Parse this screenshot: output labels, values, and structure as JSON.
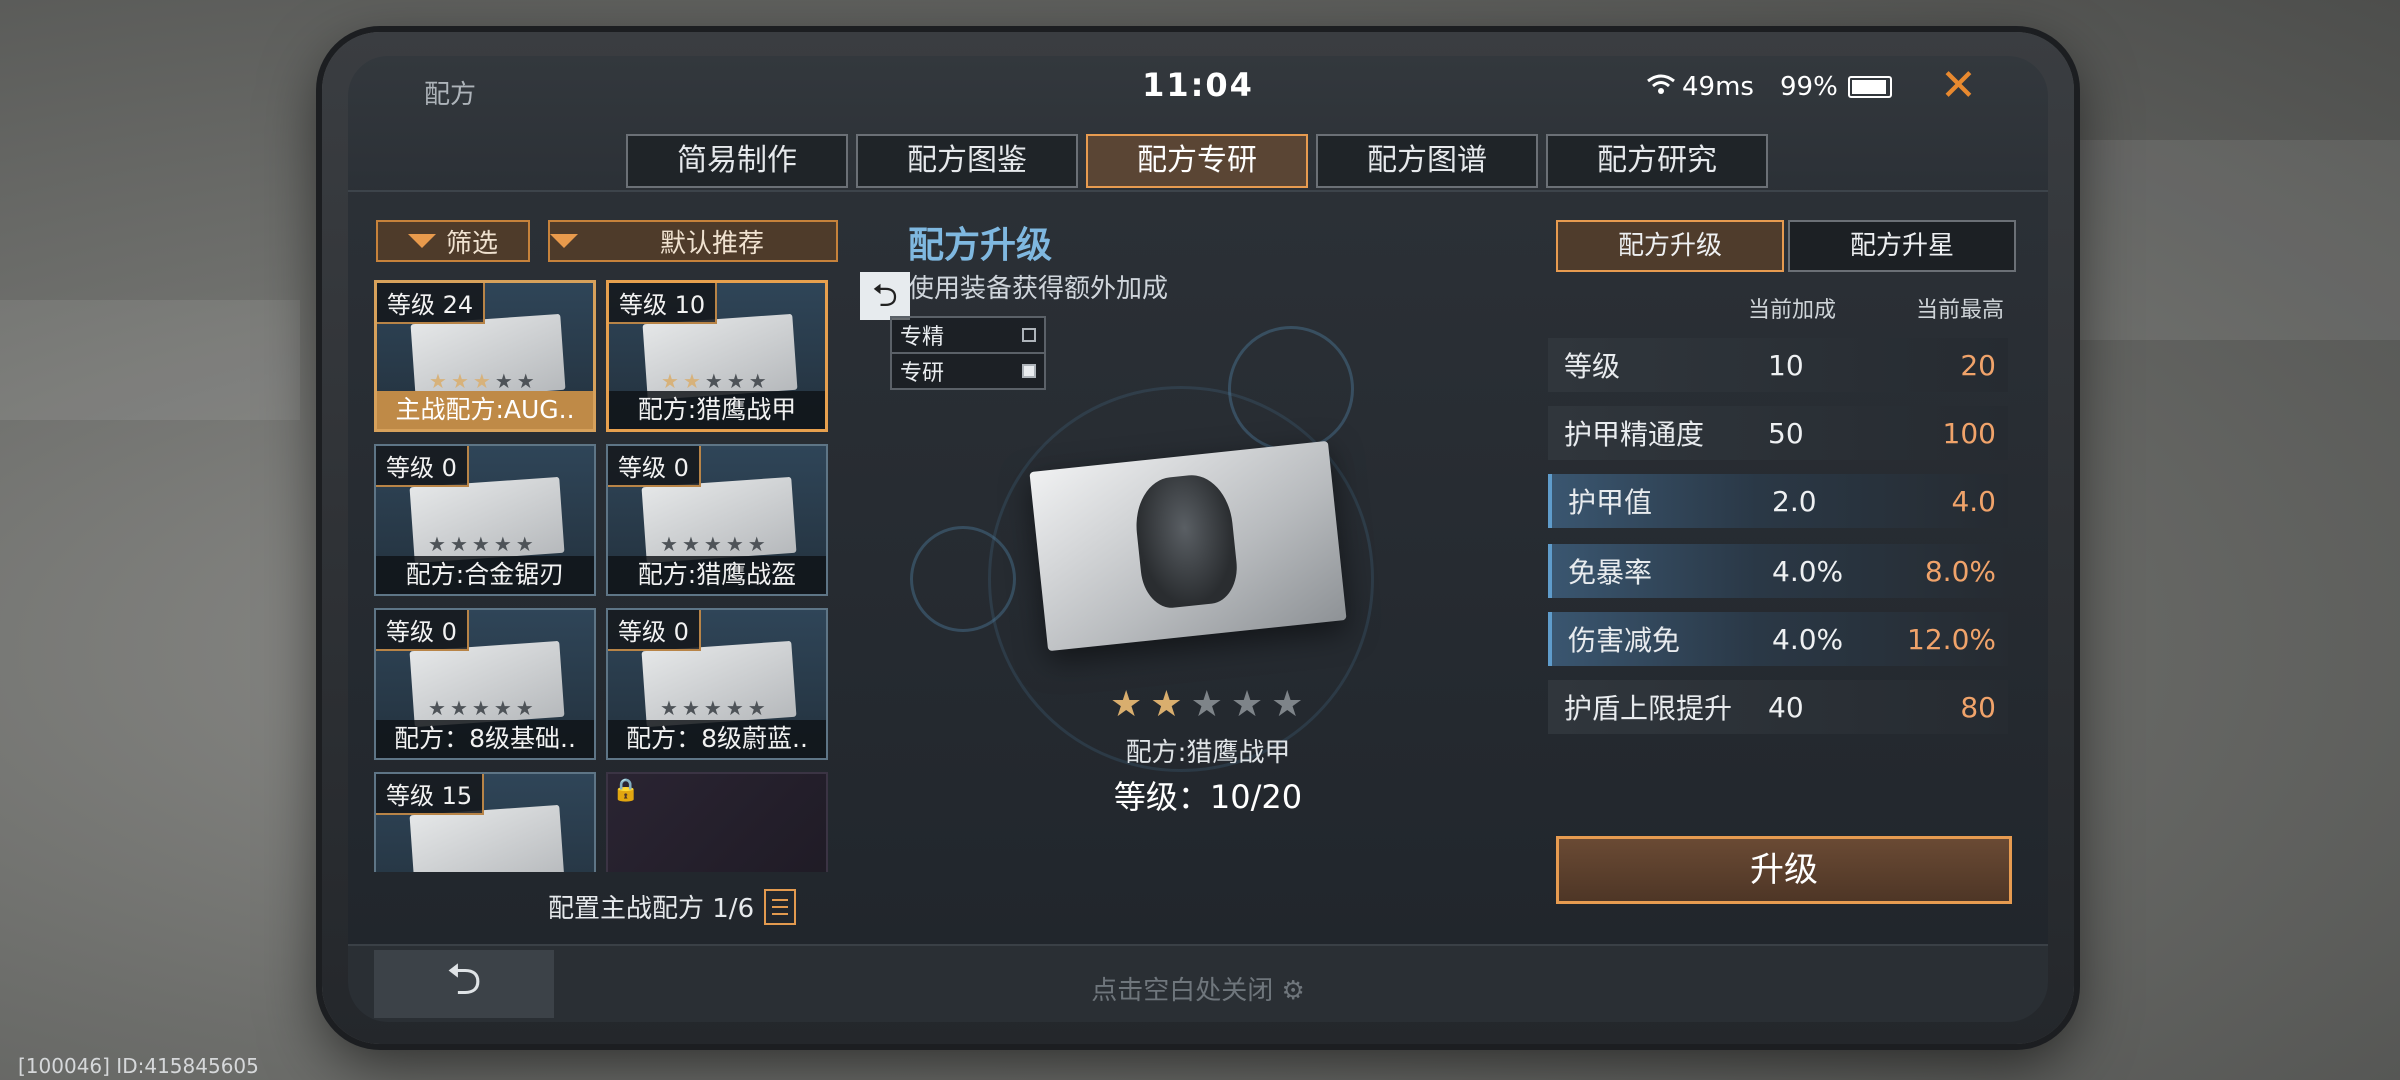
{
  "top": {
    "title": "配方",
    "time": "11:04",
    "ping": "49ms",
    "battery": "99%"
  },
  "main_tabs": [
    {
      "label": "简易制作",
      "active": false
    },
    {
      "label": "配方图鉴",
      "active": false
    },
    {
      "label": "配方专研",
      "active": true
    },
    {
      "label": "配方图谱",
      "active": false
    },
    {
      "label": "配方研究",
      "active": false
    }
  ],
  "filters": {
    "filter_label": "筛选",
    "sort_label": "默认推荐"
  },
  "recipe_cards": [
    {
      "level": "等级 24",
      "name": "主战配方:AUG..",
      "stars": 3
    },
    {
      "level": "等级 10",
      "name": "配方:猎鹰战甲",
      "stars": 2
    },
    {
      "level": "等级 0",
      "name": "配方:合金锯刃",
      "stars": 0
    },
    {
      "level": "等级 0",
      "name": "配方:猎鹰战盔",
      "stars": 0
    },
    {
      "level": "等级 0",
      "name": "配方：8级基础..",
      "stars": 0
    },
    {
      "level": "等级 0",
      "name": "配方：8级蔚蓝..",
      "stars": 0
    },
    {
      "level": "等级 15",
      "name": "",
      "stars": 0
    },
    {
      "level": "",
      "name": "",
      "stars": 0
    }
  ],
  "config_text": "配置主战配方 1/6",
  "center": {
    "title": "配方升级",
    "subtitle": "使用装备获得额外加成",
    "modes": [
      {
        "label": "专精",
        "checked": false
      },
      {
        "label": "专研",
        "checked": true
      }
    ],
    "recipe_name": "配方:猎鹰战甲",
    "level_text": "等级：10/20",
    "stars_on": 2,
    "stars_total": 5
  },
  "right": {
    "tabs": [
      {
        "label": "配方升级",
        "active": true
      },
      {
        "label": "配方升星",
        "active": false
      }
    ],
    "col_current": "当前加成",
    "col_max": "当前最高",
    "stats": [
      {
        "name": "等级",
        "current": "10",
        "max": "20"
      },
      {
        "name": "护甲精通度",
        "current": "50",
        "max": "100"
      },
      {
        "name": "护甲值",
        "current": "2.0",
        "max": "4.0"
      },
      {
        "name": "免暴率",
        "current": "4.0%",
        "max": "8.0%"
      },
      {
        "name": "伤害减免",
        "current": "4.0%",
        "max": "12.0%"
      },
      {
        "name": "护盾上限提升",
        "current": "40",
        "max": "80"
      }
    ],
    "upgrade_label": "升级"
  },
  "bottom": {
    "tap_close": "点击空白处关闭"
  },
  "footer_id": "[100046] ID:415845605"
}
